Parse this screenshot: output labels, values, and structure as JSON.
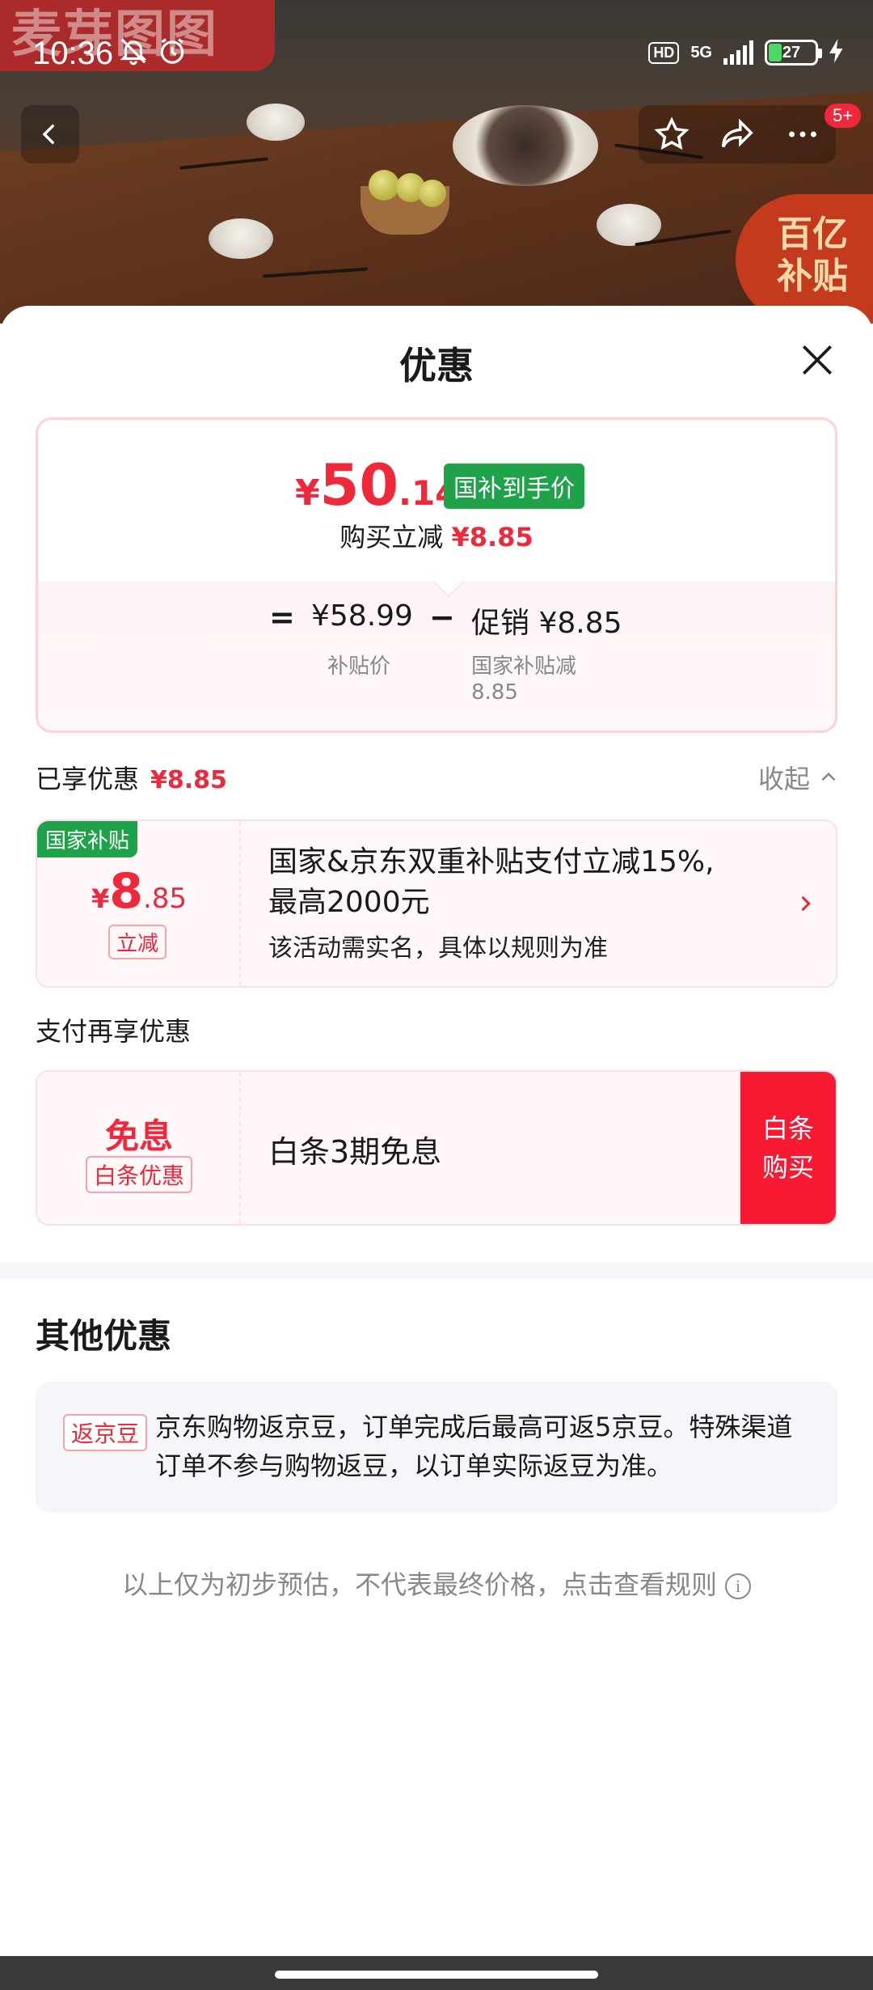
{
  "background": {
    "watermark": "麦芽图图",
    "corner_badge_line1": "百亿",
    "corner_badge_line2": "补贴"
  },
  "status_bar": {
    "time": "10:36",
    "hd": "HD",
    "network": "5G",
    "battery": "27",
    "battery_fraction": 0.27
  },
  "nav": {
    "cart_badge": "5+"
  },
  "sheet": {
    "title": "优惠",
    "price": {
      "yen": "¥",
      "integer": "50",
      "decimal": ".14",
      "tag": "国补到手价",
      "instant_label": "购买立减",
      "instant_amount": "¥8.85"
    },
    "formula": {
      "equals": "=",
      "base_price": "¥58.99",
      "base_label": "补贴价",
      "minus": "−",
      "promo_value": "促销 ¥8.85",
      "promo_label_line1": "国家补贴减",
      "promo_label_line2": "8.85"
    },
    "enjoyed": {
      "label": "已享优惠",
      "amount": "¥8.85",
      "collapse_label": "收起"
    },
    "subsidy_coupon": {
      "corner_tag": "国家补贴",
      "yen": "¥",
      "integer": "8",
      "decimal": ".85",
      "kind": "立减",
      "desc_line1": "国家&京东双重补贴支付立减15%,",
      "desc_line2": "最高2000元",
      "note": "该活动需实名，具体以规则为准"
    },
    "pay_more_label": "支付再享优惠",
    "baitiao": {
      "free_label": "免息",
      "kind": "白条优惠",
      "desc": "白条3期免息",
      "buy_line1": "白条",
      "buy_line2": "购买"
    },
    "other": {
      "title": "其他优惠",
      "tag": "返京豆",
      "text": "京东购物返京豆，订单完成后最高可返5京豆。特殊渠道订单不参与购物返豆，以订单实际返豆为准。"
    },
    "footer_note": "以上仅为初步预估，不代表最终价格，点击查看规则"
  },
  "colors": {
    "accent_red": "#f0283c",
    "buy_red": "#f71932",
    "green_tag": "#1fa34a"
  }
}
